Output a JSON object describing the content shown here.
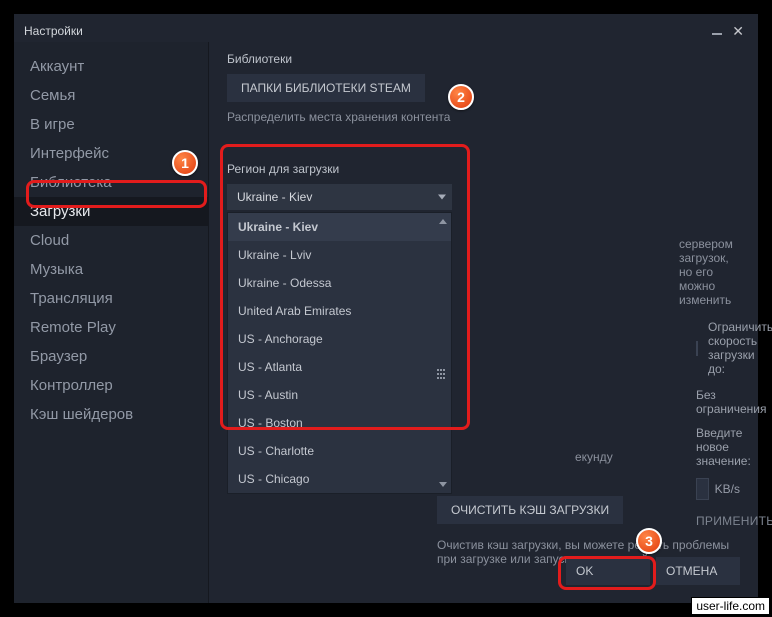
{
  "window": {
    "title": "Настройки"
  },
  "sidebar": {
    "items": [
      {
        "label": "Аккаунт"
      },
      {
        "label": "Семья"
      },
      {
        "label": "В игре"
      },
      {
        "label": "Интерфейс"
      },
      {
        "label": "Библиотека"
      },
      {
        "label": "Загрузки"
      },
      {
        "label": "Cloud"
      },
      {
        "label": "Музыка"
      },
      {
        "label": "Трансляция"
      },
      {
        "label": "Remote Play"
      },
      {
        "label": "Браузер"
      },
      {
        "label": "Контроллер"
      },
      {
        "label": "Кэш шейдеров"
      }
    ],
    "active_index": 5
  },
  "library": {
    "title": "Библиотеки",
    "button": "ПАПКИ БИБЛИОТЕКИ STEAM",
    "hint": "Распределить места хранения контента"
  },
  "region": {
    "title": "Регион для загрузки",
    "selected": "Ukraine - Kiev",
    "options": [
      "Ukraine - Kiev",
      "Ukraine - Lviv",
      "Ukraine - Odessa",
      "United Arab Emirates",
      "US - Anchorage",
      "US - Atlanta",
      "US - Austin",
      "US - Boston",
      "US - Charlotte",
      "US - Chicago"
    ],
    "server_hint": "сервером загрузок, но его можно изменить"
  },
  "limit": {
    "checkbox_label": "Ограничить скорость загрузки до:",
    "no_limit": "Без ограничения",
    "enter_label": "Введите новое значение:",
    "unit": "KB/s",
    "apply": "ПРИМЕНИТЬ"
  },
  "per_second": "екунду",
  "clear": {
    "button": "ОЧИСТИТЬ КЭШ ЗАГРУЗКИ",
    "hint": "Очистив кэш загрузки, вы можете решить проблемы при загрузке или запуске приложений"
  },
  "footer": {
    "ok": "OK",
    "cancel": "ОТМЕНА"
  },
  "annotations": {
    "b1": "1",
    "b2": "2",
    "b3": "3"
  },
  "watermark": "user-life.com"
}
